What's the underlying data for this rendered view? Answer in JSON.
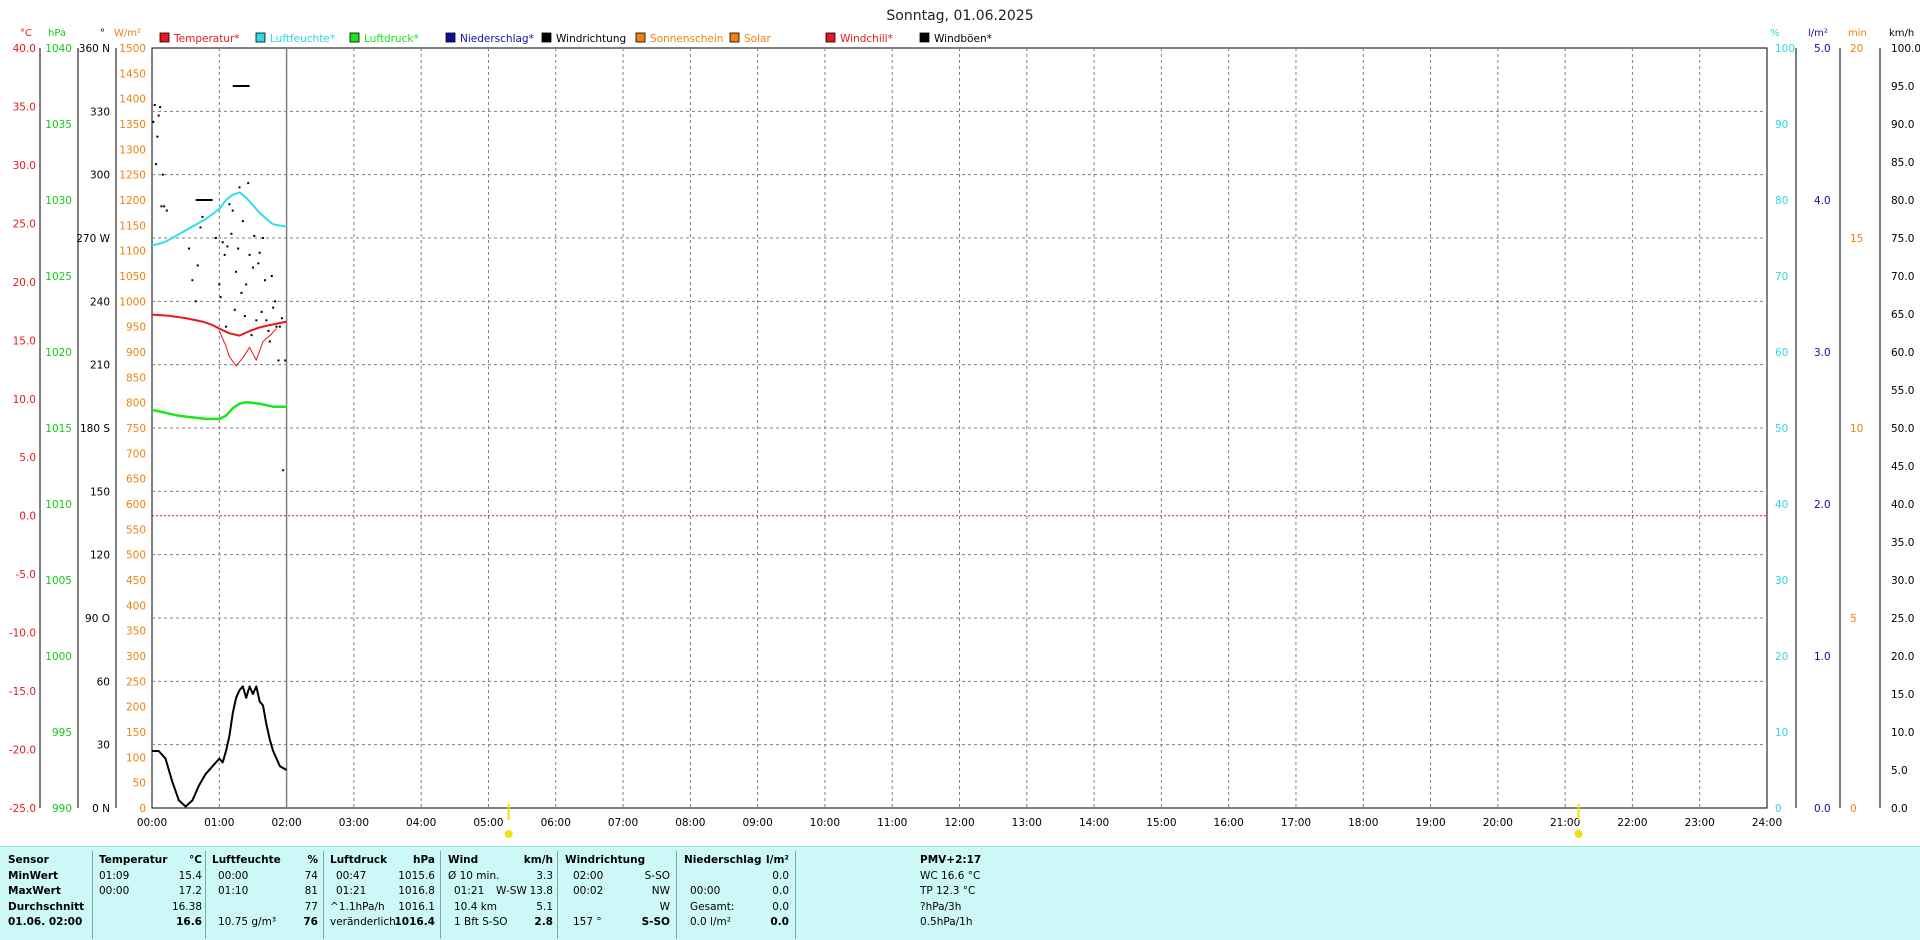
{
  "title": "Sonntag, 01.06.2025",
  "axes": {
    "left_units": [
      "°C",
      "hPa",
      "°",
      "W/m²"
    ],
    "right_units": [
      "%",
      "l/m²",
      "min",
      "km/h"
    ],
    "temperature": [
      "40.0",
      "35.0",
      "30.0",
      "25.0",
      "20.0",
      "15.0",
      "10.0",
      "5.0",
      "0.0",
      "-5.0",
      "-10.0",
      "-15.0",
      "-20.0",
      "-25.0"
    ],
    "pressure": [
      "1040",
      "1035",
      "1030",
      "1025",
      "1020",
      "1015",
      "1010",
      "1005",
      "1000",
      "995",
      "990"
    ],
    "direction": [
      "360 N",
      "330",
      "300",
      "270 W",
      "240",
      "210",
      "180 S",
      "150",
      "120",
      "90 O",
      "60",
      "30",
      "0 N"
    ],
    "solar": [
      "1500",
      "1450",
      "1400",
      "1350",
      "1300",
      "1250",
      "1200",
      "1150",
      "1100",
      "1050",
      "1000",
      "950",
      "900",
      "850",
      "800",
      "750",
      "700",
      "650",
      "600",
      "550",
      "500",
      "450",
      "400",
      "350",
      "300",
      "250",
      "200",
      "150",
      "100",
      "50",
      "0"
    ],
    "humidity": [
      "100",
      "90",
      "80",
      "70",
      "60",
      "50",
      "40",
      "30",
      "20",
      "10",
      "0"
    ],
    "rain": [
      "5.0",
      "4.0",
      "3.0",
      "2.0",
      "1.0",
      "0.0"
    ],
    "minutes": [
      "20",
      "15",
      "10",
      "5",
      "0"
    ],
    "wind": [
      "100.0",
      "95.0",
      "90.0",
      "85.0",
      "80.0",
      "75.0",
      "70.0",
      "65.0",
      "60.0",
      "55.0",
      "50.0",
      "45.0",
      "40.0",
      "35.0",
      "30.0",
      "25.0",
      "20.0",
      "15.0",
      "10.0",
      "5.0",
      "0.0"
    ],
    "time": [
      "00:00",
      "01:00",
      "02:00",
      "03:00",
      "04:00",
      "05:00",
      "06:00",
      "07:00",
      "08:00",
      "09:00",
      "10:00",
      "11:00",
      "12:00",
      "13:00",
      "14:00",
      "15:00",
      "16:00",
      "17:00",
      "18:00",
      "19:00",
      "20:00",
      "21:00",
      "22:00",
      "23:00",
      "24:00"
    ]
  },
  "legend": [
    {
      "label": "Temperatur*",
      "color": "#e8191d",
      "text_color": "#e8191d"
    },
    {
      "label": "Luftfeuchte*",
      "color": "#30d8e0",
      "text_color": "#30d8e0"
    },
    {
      "label": "Luftdruck*",
      "color": "#18e818",
      "text_color": "#18e818"
    },
    {
      "label": "Niederschlag*",
      "color": "#1010a0",
      "text_color": "#1010a0"
    },
    {
      "label": "Windrichtung",
      "color": "#000000",
      "text_color": "#000000"
    },
    {
      "label": "Sonnenschein",
      "color": "#f08010",
      "text_color": "#f08010"
    },
    {
      "label": "Solar",
      "color": "#f08010",
      "text_color": "#f08010"
    },
    {
      "label": "Windchill*",
      "color": "#e8191d",
      "text_color": "#e8191d"
    },
    {
      "label": "Windböen*",
      "color": "#000000",
      "text_color": "#000000"
    }
  ],
  "colors": {
    "temperature": "#e8191d",
    "humidity": "#30e0e8",
    "pressure": "#18e818",
    "rain": "#1010a0",
    "sunshine": "#f08010",
    "wind": "#000000",
    "sun_marker": "#f0e010",
    "zero_line": "#e8191d",
    "grid": "#808080"
  },
  "chart_data": {
    "type": "line",
    "title": "Sonntag, 01.06.2025",
    "x_unit": "hours",
    "xlim": [
      0,
      24
    ],
    "series": [
      {
        "name": "Temperatur*",
        "axis": "°C",
        "ylim": [
          -25,
          40
        ],
        "x": [
          0,
          0.25,
          0.5,
          0.75,
          0.9,
          1.0,
          1.15,
          1.3,
          1.45,
          1.6,
          1.75,
          2.0
        ],
        "y": [
          17.2,
          17.1,
          16.9,
          16.6,
          16.3,
          16.0,
          15.6,
          15.4,
          15.8,
          16.1,
          16.3,
          16.6
        ]
      },
      {
        "name": "Windchill*",
        "axis": "°C",
        "ylim": [
          -25,
          40
        ],
        "x": [
          1.0,
          1.1,
          1.15,
          1.25,
          1.35,
          1.45,
          1.55,
          1.65,
          1.75,
          1.85
        ],
        "y": [
          15.8,
          14.5,
          13.6,
          12.8,
          13.5,
          14.4,
          13.3,
          14.9,
          15.4,
          16.0
        ]
      },
      {
        "name": "Luftfeuchte*",
        "axis": "%",
        "ylim": [
          0,
          100
        ],
        "x": [
          0,
          0.2,
          0.4,
          0.6,
          0.8,
          1.0,
          1.1,
          1.2,
          1.3,
          1.4,
          1.5,
          1.6,
          1.7,
          1.8,
          2.0
        ],
        "y": [
          74,
          74.5,
          75.5,
          76.5,
          77.5,
          78.8,
          80,
          80.7,
          81,
          80.3,
          79.3,
          78.3,
          77.5,
          76.8,
          76.5
        ]
      },
      {
        "name": "Luftdruck*",
        "axis": "hPa",
        "ylim": [
          990,
          1040
        ],
        "x": [
          0,
          0.2,
          0.4,
          0.6,
          0.8,
          1.0,
          1.1,
          1.2,
          1.3,
          1.4,
          1.6,
          1.8,
          2.0
        ],
        "y": [
          1016.2,
          1016.0,
          1015.8,
          1015.7,
          1015.6,
          1015.6,
          1015.8,
          1016.3,
          1016.6,
          1016.7,
          1016.6,
          1016.4,
          1016.4
        ]
      },
      {
        "name": "Windböen*",
        "axis": "km/h",
        "ylim": [
          0,
          100
        ],
        "x": [
          0,
          0.1,
          0.2,
          0.3,
          0.4,
          0.5,
          0.6,
          0.7,
          0.8,
          0.9,
          1.0,
          1.05,
          1.1,
          1.15,
          1.2,
          1.25,
          1.3,
          1.35,
          1.4,
          1.45,
          1.5,
          1.55,
          1.6,
          1.65,
          1.7,
          1.75,
          1.8,
          1.9,
          2.0
        ],
        "y": [
          7.5,
          7.5,
          6.5,
          3.5,
          1.0,
          0.2,
          1.0,
          3.0,
          4.5,
          5.5,
          6.5,
          6.0,
          7.5,
          9.5,
          12.5,
          14.5,
          15.5,
          16.0,
          14.5,
          16.0,
          15.0,
          16.0,
          14.0,
          13.5,
          11.0,
          9.0,
          7.5,
          5.5,
          5.0
        ]
      },
      {
        "name": "Windrichtung",
        "axis": "°",
        "ylim": [
          0,
          360
        ],
        "style": "dots",
        "x": [
          0.02,
          0.04,
          0.06,
          0.08,
          0.1,
          0.12,
          0.14,
          0.16,
          0.18,
          0.22,
          0.55,
          0.6,
          0.65,
          0.68,
          0.72,
          0.75,
          0.95,
          1.0,
          1.02,
          1.05,
          1.08,
          1.1,
          1.12,
          1.15,
          1.18,
          1.2,
          1.23,
          1.25,
          1.28,
          1.3,
          1.33,
          1.35,
          1.38,
          1.4,
          1.43,
          1.45,
          1.48,
          1.5,
          1.52,
          1.55,
          1.58,
          1.6,
          1.63,
          1.65,
          1.68,
          1.7,
          1.73,
          1.75,
          1.78,
          1.8,
          1.83,
          1.85,
          1.88,
          1.9,
          1.93,
          1.95,
          1.98
        ],
        "y": [
          325,
          333,
          305,
          318,
          328,
          332,
          285,
          300,
          285,
          283,
          265,
          250,
          240,
          257,
          275,
          280,
          270,
          248,
          242,
          268,
          262,
          228,
          266,
          286,
          272,
          283,
          236,
          254,
          265,
          294,
          244,
          278,
          233,
          248,
          296,
          262,
          224,
          256,
          271,
          231,
          258,
          263,
          235,
          270,
          250,
          231,
          226,
          221,
          252,
          237,
          240,
          228,
          212,
          228,
          232,
          160,
          212
        ]
      }
    ],
    "wind_direction_labels": [
      "360 N",
      "270 W",
      "180 S",
      "90 O",
      "0 N"
    ],
    "sunshine_marks": [
      {
        "hour": 1.3,
        "minutes": 19
      },
      {
        "hour": 0.75,
        "minutes": 16
      }
    ],
    "sun_times": [
      5.3,
      21.2
    ],
    "reference_lines": [
      {
        "axis": "°C",
        "value": 0,
        "style": "dotted",
        "color": "#e8191d"
      }
    ]
  },
  "panel": {
    "sensor": {
      "header": "Sensor",
      "rows": [
        "MinWert",
        "MaxWert",
        "Durchschnitt",
        "01.06. 02:00"
      ]
    },
    "temperature": {
      "header": "Temperatur",
      "unit": "°C",
      "rows": [
        [
          "01:09",
          "15.4"
        ],
        [
          "00:00",
          "17.2"
        ],
        [
          "",
          "16.38"
        ],
        [
          "",
          "16.6"
        ]
      ]
    },
    "humidity": {
      "header": "Luftfeuchte",
      "unit": "%",
      "rows": [
        [
          "00:00",
          "74"
        ],
        [
          "01:10",
          "81"
        ],
        [
          "",
          "77"
        ],
        [
          "10.75 g/m³",
          "76"
        ]
      ]
    },
    "pressure": {
      "header": "Luftdruck",
      "unit": "hPa",
      "rows": [
        [
          "00:47",
          "1015.6"
        ],
        [
          "01:21",
          "1016.8"
        ],
        [
          "^1.1hPa/h",
          "1016.1"
        ],
        [
          "veränderlich",
          "1016.4"
        ]
      ]
    },
    "wind": {
      "header": "Wind",
      "unit": "km/h",
      "rows": [
        [
          "Ø 10 min.",
          "",
          "3.3"
        ],
        [
          "01:21",
          "W-SW",
          "13.8"
        ],
        [
          "10.4 km",
          "",
          "5.1"
        ],
        [
          "1 Bft S-SO",
          "",
          "2.8"
        ]
      ]
    },
    "direction": {
      "header": "Windrichtung",
      "rows": [
        [
          "02:00",
          "S-SO"
        ],
        [
          "00:02",
          "NW"
        ],
        [
          "",
          "W"
        ],
        [
          "157 °",
          "S-SO"
        ]
      ]
    },
    "rain": {
      "header": "Niederschlag",
      "unit": "l/m²",
      "rows": [
        [
          "",
          "0.0"
        ],
        [
          "00:00",
          "0.0"
        ],
        [
          "Gesamt:",
          "0.0"
        ],
        [
          "0.0 l/m²",
          "0.0"
        ]
      ]
    },
    "extra": {
      "rows": [
        "PMV+2:17",
        "WC 16.6 °C",
        "TP 12.3 °C",
        "?hPa/3h",
        "0.5hPa/1h"
      ]
    }
  }
}
